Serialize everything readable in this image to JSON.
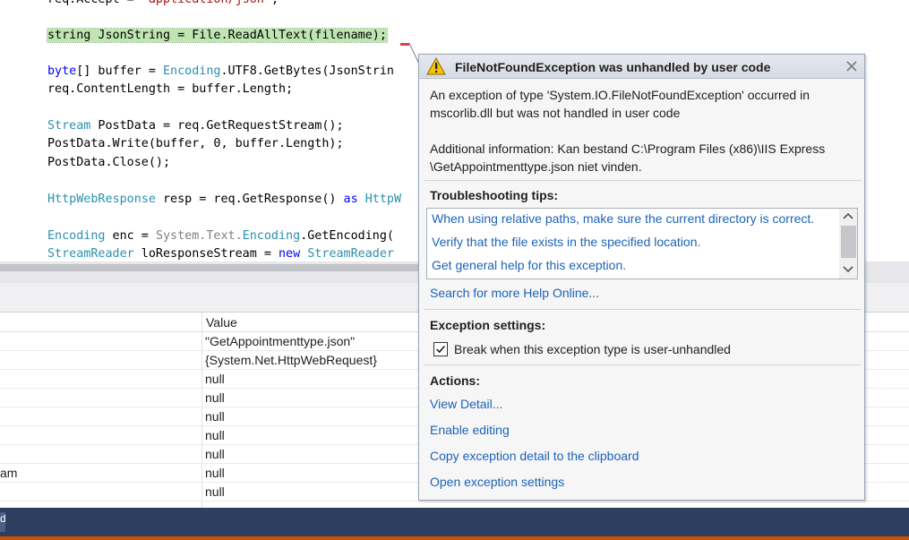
{
  "editor": {
    "lines": [
      {
        "parts": [
          {
            "t": "req.Accept = ",
            "c": ""
          },
          {
            "t": "\"application/json\"",
            "c": "str"
          },
          {
            "t": ";",
            "c": ""
          }
        ]
      },
      {
        "parts": [
          {
            "t": "string JsonString = File.ReadAllText(filename);",
            "c": "hl"
          }
        ]
      },
      {
        "parts": [
          {
            "t": "byte",
            "c": "kw"
          },
          {
            "t": "[] buffer = ",
            "c": ""
          },
          {
            "t": "Encoding",
            "c": "ty"
          },
          {
            "t": ".UTF8.GetBytes(JsonStrin",
            "c": ""
          }
        ]
      },
      {
        "parts": [
          {
            "t": "req.ContentLength = buffer.Length;",
            "c": ""
          }
        ]
      },
      {
        "parts": [
          {
            "t": "Stream",
            "c": "ty"
          },
          {
            "t": " PostData = req.GetRequestStream();",
            "c": ""
          }
        ]
      },
      {
        "parts": [
          {
            "t": "PostData.Write(buffer, 0, buffer.Length);",
            "c": ""
          }
        ]
      },
      {
        "parts": [
          {
            "t": "PostData.Close();",
            "c": ""
          }
        ]
      },
      {
        "parts": [
          {
            "t": "HttpWebResponse",
            "c": "ty"
          },
          {
            "t": " resp = req.GetResponse() ",
            "c": ""
          },
          {
            "t": "as",
            "c": "kw"
          },
          {
            "t": " HttpW",
            "c": "ty"
          }
        ]
      },
      {
        "parts": [
          {
            "t": "Encoding",
            "c": "ty"
          },
          {
            "t": " enc = ",
            "c": ""
          },
          {
            "t": "System.Text.",
            "c": "gr"
          },
          {
            "t": "Encoding",
            "c": "ty"
          },
          {
            "t": ".GetEncoding(",
            "c": ""
          }
        ]
      },
      {
        "parts": [
          {
            "t": "StreamReader",
            "c": "ty"
          },
          {
            "t": " loResponseStream = ",
            "c": ""
          },
          {
            "t": "new",
            "c": "kw"
          },
          {
            "t": " StreamReader",
            "c": "ty"
          }
        ]
      }
    ]
  },
  "locals": {
    "value_header": "Value",
    "rows": [
      {
        "name": "",
        "value": "\"GetAppointmenttype.json\""
      },
      {
        "name": "",
        "value": "{System.Net.HttpWebRequest}"
      },
      {
        "name": "",
        "value": "null"
      },
      {
        "name": "",
        "value": "null"
      },
      {
        "name": "",
        "value": "null"
      },
      {
        "name": "",
        "value": "null"
      },
      {
        "name": "",
        "value": "null"
      },
      {
        "name": "am",
        "value": "null"
      },
      {
        "name": "",
        "value": "null"
      }
    ]
  },
  "bottom_bar": {
    "tab_label": "d"
  },
  "exception": {
    "title": "FileNotFoundException was unhandled by user code",
    "message_line1": "An exception of type 'System.IO.FileNotFoundException' occurred in",
    "message_line2": "mscorlib.dll but was not handled in user code",
    "info_line1": "Additional information: Kan bestand C:\\Program Files (x86)\\IIS Express",
    "info_line2": "\\GetAppointmenttype.json niet vinden.",
    "tips_title": "Troubleshooting tips:",
    "tips": [
      "When using relative paths, make sure the current directory is correct.",
      "Verify that the file exists in the specified location.",
      "Get general help for this exception."
    ],
    "search_link": "Search for more Help Online...",
    "settings_title": "Exception settings:",
    "break_checkbox_label": "Break when this exception type is user-unhandled",
    "break_checked": true,
    "actions_title": "Actions:",
    "actions": [
      "View Detail...",
      "Enable editing",
      "Copy exception detail to the clipboard",
      "Open exception settings"
    ]
  },
  "colors": {
    "keyword": "#0000ff",
    "type": "#2b91af",
    "string": "#a31515",
    "link": "#1c63b8",
    "selection_highlight": "#bfe6b2",
    "status_bar": "#ca5100",
    "panel_bar": "#2d3e5e",
    "warning": "#f5c400"
  },
  "icons": {
    "title": "warning-icon",
    "close": "close-icon",
    "checkbox": "checkmark-icon",
    "scroll_up": "chevron-up-icon",
    "scroll_down": "chevron-down-icon"
  }
}
